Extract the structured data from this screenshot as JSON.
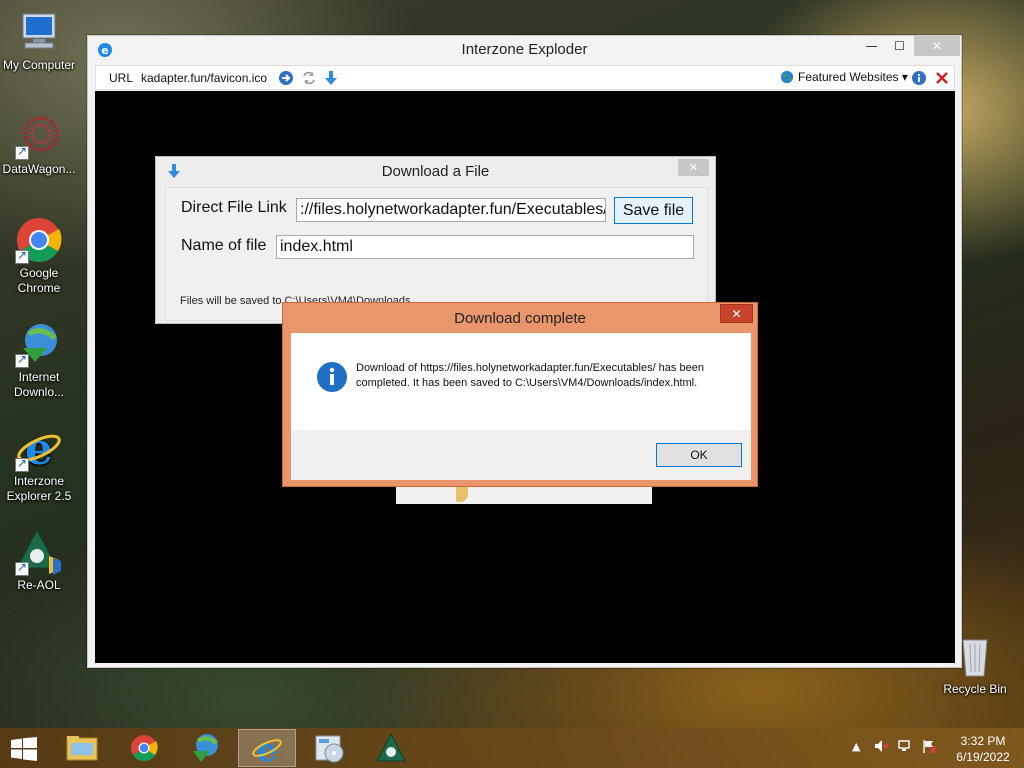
{
  "desktop": {
    "icons": [
      {
        "label": "My Computer"
      },
      {
        "label": "DataWagon..."
      },
      {
        "label": "Google Chrome"
      },
      {
        "label": "Internet Downlo..."
      },
      {
        "label": "Interzone Explorer 2.5"
      },
      {
        "label": "Re-AOL"
      },
      {
        "label": "Recycle Bin"
      }
    ]
  },
  "browser": {
    "title": "Interzone Exploder",
    "minimize_label": "—",
    "maximize_label": "☐",
    "close_label": "✕",
    "toolbar": {
      "url_label": "URL",
      "url_value": "kadapter.fun/favicon.ico",
      "featured_label": "Featured Websites ▾"
    }
  },
  "download_dialog": {
    "title": "Download a File",
    "close_label": "✕",
    "link_label": "Direct File Link",
    "link_value": "://files.holynetworkadapter.fun/Executables/",
    "save_button": "Save file",
    "name_label": "Name of file",
    "name_value": "index.html",
    "note": "Files will be saved to C:\\Users\\VM4\\Downloads"
  },
  "message_box": {
    "title": "Download complete",
    "close_label": "✕",
    "message": "Download of https://files.holynetworkadapter.fun/Executables/ has been completed. It has been saved to C:\\Users\\VM4/Downloads/index.html.",
    "ok_button": "OK"
  },
  "taskbar": {
    "clock_time": "3:32 PM",
    "clock_date": "6/19/2022"
  },
  "colors": {
    "dialog_accent": "#e9966c",
    "close_red": "#c7432b",
    "button_focus": "#0078d7"
  }
}
